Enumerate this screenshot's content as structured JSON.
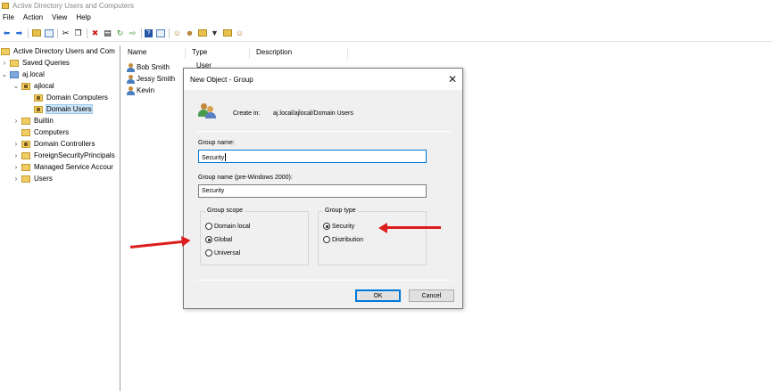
{
  "window": {
    "title": "Active Directory Users and Computers"
  },
  "menu": [
    "File",
    "Action",
    "View",
    "Help"
  ],
  "toolbar": {
    "icons": [
      "back-arrow-icon",
      "forward-arrow-icon",
      "folder-up-icon",
      "show-console-tree-icon",
      "cut-icon",
      "copy-icon",
      "delete-icon",
      "properties-icon",
      "refresh-icon",
      "export-list-icon",
      "help-icon",
      "details-view-icon",
      "new-user-icon",
      "new-group-icon",
      "new-ou-icon",
      "filter-icon",
      "find-icon",
      "add-to-group-icon"
    ]
  },
  "tree": {
    "root": "Active Directory Users and Com",
    "items": [
      {
        "label": "Saved Queries"
      },
      {
        "label": "aj.local"
      },
      {
        "label": "ajlocal"
      },
      {
        "label": "Domain Computers"
      },
      {
        "label": "Domain Users"
      },
      {
        "label": "Builtin"
      },
      {
        "label": "Computers"
      },
      {
        "label": "Domain Controllers"
      },
      {
        "label": "ForeignSecurityPrincipals"
      },
      {
        "label": "Managed Service Accour"
      },
      {
        "label": "Users"
      }
    ]
  },
  "list": {
    "columns": [
      "Name",
      "Type",
      "Description"
    ],
    "rows": [
      {
        "name": "Bob Smith",
        "type": "User"
      },
      {
        "name": "Jessy Smith",
        "type": ""
      },
      {
        "name": "Kevin",
        "type": ""
      }
    ]
  },
  "dialog": {
    "title": "New Object - Group",
    "create_in_label": "Create in:",
    "create_in_path": "aj.local/ajlocal/Domain Users",
    "group_name_label": "Group name:",
    "group_name_value": "Security",
    "group_name_pre2000_label": "Group name (pre-Windows 2000):",
    "group_name_pre2000_value": "Security",
    "scope": {
      "legend": "Group scope",
      "options": [
        "Domain local",
        "Global",
        "Universal"
      ],
      "selected": "Global"
    },
    "type": {
      "legend": "Group type",
      "options": [
        "Security",
        "Distribution"
      ],
      "selected": "Security"
    },
    "ok_label": "OK",
    "cancel_label": "Cancel"
  },
  "annotation_color": "#dd1d1d"
}
